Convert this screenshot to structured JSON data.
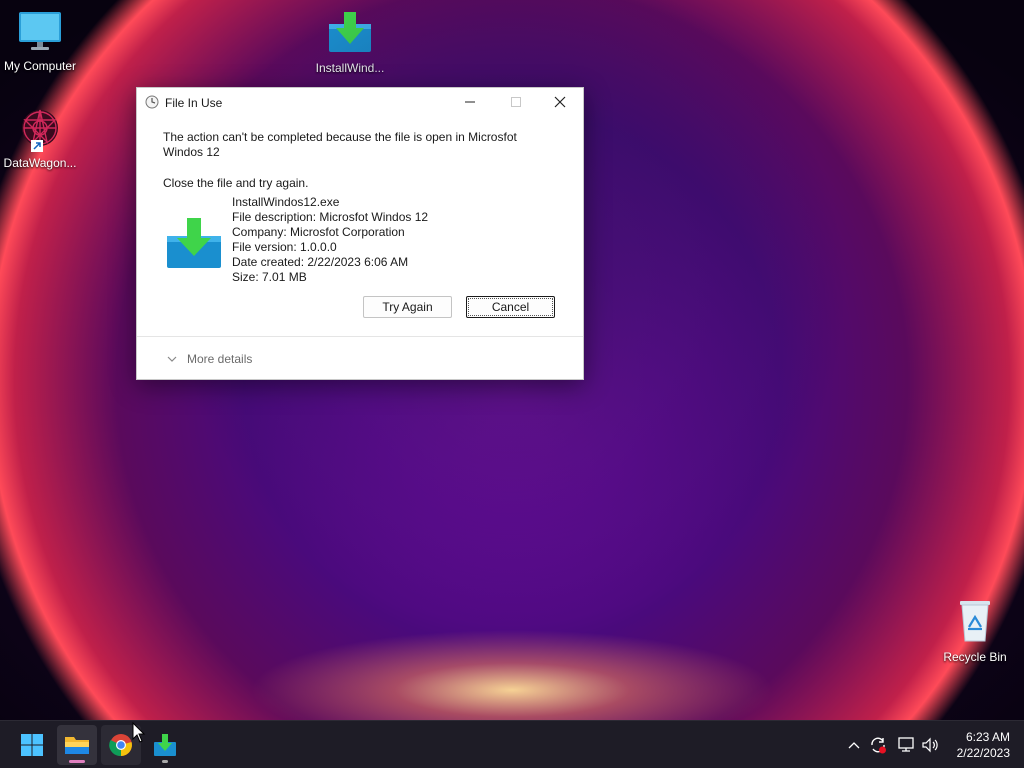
{
  "desktop": {
    "icons": [
      {
        "label": "My Computer",
        "icon": "monitor-icon"
      },
      {
        "label": "InstallWind...",
        "icon": "installer-icon"
      },
      {
        "label": "DataWagon...",
        "icon": "datawagon-icon"
      },
      {
        "label": "Recycle Bin",
        "icon": "recycle-bin-icon"
      }
    ]
  },
  "dialog": {
    "title": "File In Use",
    "message": "The action can't be completed because the file is open in Microsfot Windos 12",
    "instruction": "Close the file and try again.",
    "file": {
      "name": "InstallWindos12.exe",
      "description": "File description: Microsfot Windos 12",
      "company": "Company: Microsfot Corporation",
      "version": "File version: 1.0.0.0",
      "date_created": "Date created: 2/22/2023 6:06 AM",
      "size": "Size: 7.01 MB"
    },
    "buttons": {
      "try_again": "Try Again",
      "cancel": "Cancel"
    },
    "more_details": "More details"
  },
  "taskbar": {
    "apps": [
      "start-icon",
      "file-explorer-icon",
      "chrome-icon",
      "installer-icon"
    ],
    "clock": {
      "time": "6:23 AM",
      "date": "2/22/2023"
    },
    "colors": {
      "accent": "#0078d4",
      "explorer_indicator": "#e080c0"
    }
  }
}
